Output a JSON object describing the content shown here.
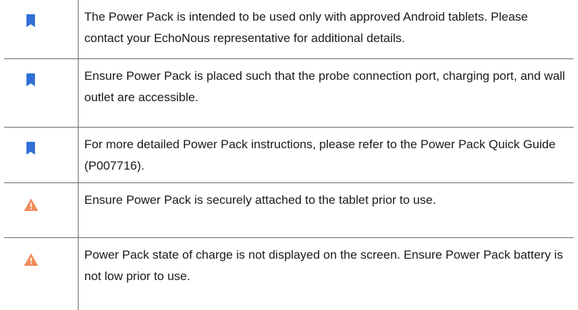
{
  "notes": [
    {
      "icon": "bookmark-icon",
      "color": "#2f6fd6",
      "text": " The Power Pack is intended to be used only with approved Android tablets. Please contact your EchoNous representative for additional details."
    },
    {
      "icon": "bookmark-icon",
      "color": "#2f6fd6",
      "text": "Ensure Power Pack is placed such that the probe connection port, charging port, and wall outlet are accessible."
    },
    {
      "icon": "bookmark-icon",
      "color": "#2f6fd6",
      "text": "For more detailed Power Pack instructions, please refer to the Power Pack Quick Guide (P007716)."
    },
    {
      "icon": "warning-icon",
      "color": "#f08c5a",
      "text": "Ensure Power Pack is securely attached to the tablet prior to use."
    },
    {
      "icon": "warning-icon",
      "color": "#f08c5a",
      "text": "Power Pack state of charge is not displayed on the screen. Ensure Power Pack battery is not low prior to use."
    }
  ]
}
